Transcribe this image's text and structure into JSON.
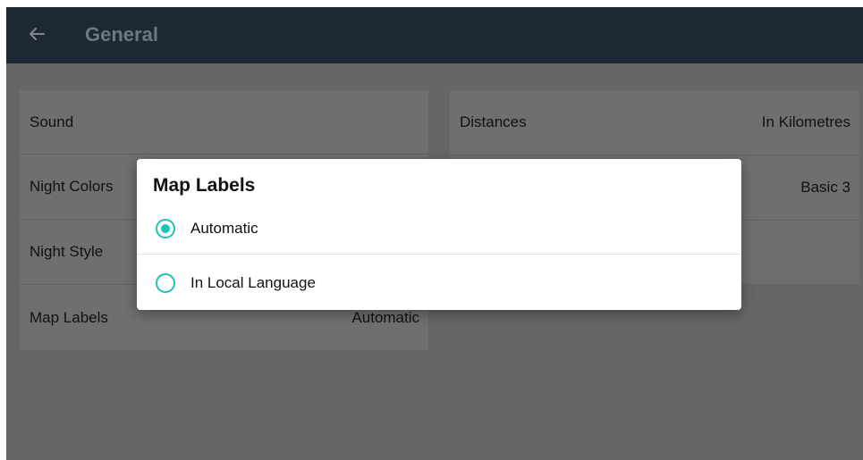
{
  "header": {
    "title": "General",
    "back_icon": "arrow-left-icon"
  },
  "settings_left": [
    {
      "label": "Sound",
      "value": ""
    },
    {
      "label": "Night Colors",
      "value": ""
    },
    {
      "label": "Night Style",
      "value": ""
    },
    {
      "label": "Map Labels",
      "value": "Automatic"
    }
  ],
  "settings_right": [
    {
      "label": "Distances",
      "value": "In Kilometres"
    },
    {
      "label": "",
      "value": "Basic 3"
    },
    {
      "label": "",
      "value": ""
    }
  ],
  "dialog": {
    "title": "Map Labels",
    "options": [
      {
        "label": "Automatic",
        "selected": true
      },
      {
        "label": "In Local Language",
        "selected": false
      }
    ]
  },
  "colors": {
    "app_bar": "#1e2834",
    "accent": "#1ec2b6",
    "scrim": "#666666"
  }
}
